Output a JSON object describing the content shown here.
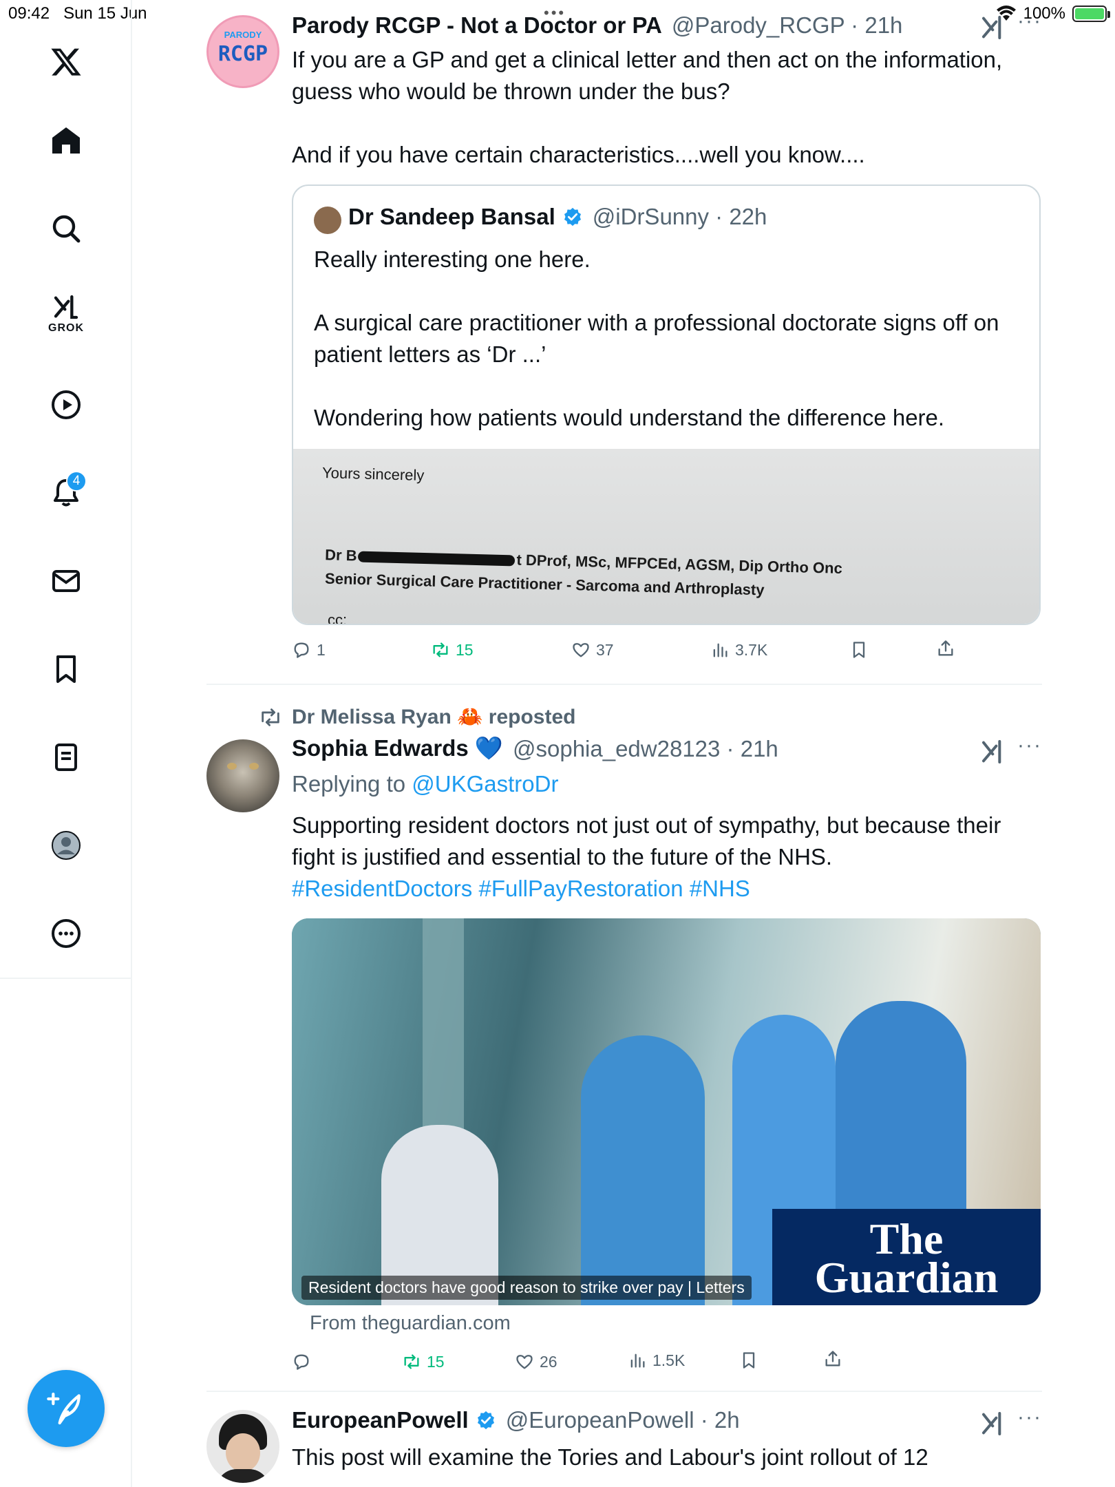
{
  "status_bar": {
    "time": "09:42",
    "date": "Sun 15 Jun",
    "battery": "100%"
  },
  "sidebar": {
    "grok_label": "GROK",
    "notifications_badge": "4"
  },
  "post1": {
    "author_name": "Parody RCGP - Not a Doctor or PA",
    "handle_time": "@Parody_RCGP · 21h",
    "avatar_text_top": "PARODY",
    "avatar_text_main": "RCGP",
    "text": "If you are a GP and get a clinical letter and then act on the information, guess who would be thrown under the bus?\n\nAnd if you have certain characteristics....well you know....",
    "quote": {
      "author_name": "Dr Sandeep Bansal",
      "handle_time": "@iDrSunny · 22h",
      "text": "Really interesting one here.\n\nA surgical care practitioner with a professional doctorate signs off on patient letters as ‘Dr ...’\n\nWondering how patients would understand the difference here.",
      "letter": {
        "line1": "Yours sincerely",
        "line2_prefix": "Dr B",
        "line2_suffix": "t DProf, MSc, MFPCEd, AGSM, Dip Ortho Onc",
        "line3": "Senior Surgical Care Practitioner - Sarcoma and Arthroplasty",
        "line4": "cc:"
      }
    },
    "replies": "1",
    "reposts": "15",
    "likes": "37",
    "views": "3.7K"
  },
  "post2": {
    "reposted_by": "Dr Melissa Ryan 🦀 reposted",
    "author_name": "Sophia Edwards 💙",
    "handle_time": "@sophia_edw28123 · 21h",
    "replying_prefix": "Replying to ",
    "replying_to": "@UKGastroDr",
    "text": "Supporting resident doctors not just out of sympathy, but because their fight is justified and essential to the future of the NHS.",
    "hashtags": "#ResidentDoctors #FullPayRestoration #NHS",
    "card_caption": "Resident doctors have good reason to strike over pay | Letters",
    "card_brand_line1": "The",
    "card_brand_line2": "Guardian",
    "card_source": "From theguardian.com",
    "reposts": "15",
    "likes": "26",
    "views": "1.5K"
  },
  "post3": {
    "author_name": "EuropeanPowell",
    "handle_time": "@EuropeanPowell · 2h",
    "text": "This post will examine the Tories and Labour's joint rollout of 12"
  },
  "colors": {
    "accent": "#1d9bf0",
    "repost_green": "#00ba7c",
    "muted": "#536471",
    "guardian_blue": "#052962"
  }
}
